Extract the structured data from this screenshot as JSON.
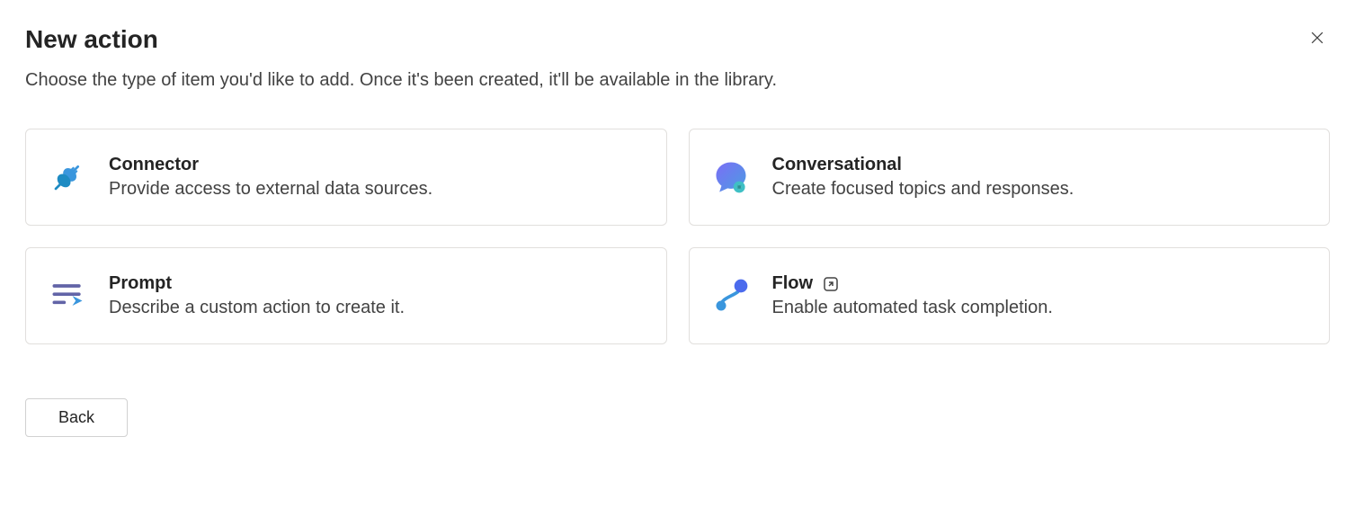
{
  "header": {
    "title": "New action",
    "subtitle": "Choose the type of item you'd like to add. Once it's been created, it'll be available in the library."
  },
  "cards": {
    "connector": {
      "title": "Connector",
      "desc": "Provide access to external data sources."
    },
    "conversational": {
      "title": "Conversational",
      "desc": "Create focused topics and responses."
    },
    "prompt": {
      "title": "Prompt",
      "desc": "Describe a custom action to create it."
    },
    "flow": {
      "title": "Flow",
      "desc": "Enable automated task completion."
    }
  },
  "footer": {
    "back_label": "Back"
  }
}
